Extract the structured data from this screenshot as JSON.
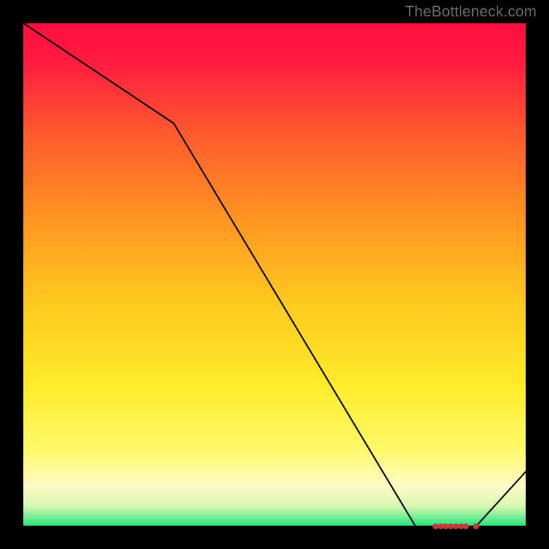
{
  "watermark": "TheBottleneck.com",
  "chart_data": {
    "type": "line",
    "title": "",
    "xlabel": "",
    "ylabel": "",
    "xlim": [
      0,
      100
    ],
    "ylim": [
      0,
      100
    ],
    "grid": false,
    "legend": false,
    "x": [
      0,
      30,
      78,
      82,
      90,
      100
    ],
    "y": [
      100,
      80,
      0,
      0,
      0,
      11
    ],
    "markers": {
      "x": [
        82,
        83,
        84,
        85,
        86,
        87,
        88,
        90
      ],
      "y": [
        0,
        0,
        0,
        0,
        0,
        0,
        0,
        0
      ]
    },
    "plot_background_gradient": {
      "top": "#FF1744",
      "upper_mid": "#FF8A00",
      "mid": "#FFEB3B",
      "lower_mid": "#FFFDE7",
      "bottom": "#00E676"
    },
    "figure_background": "#000000"
  }
}
